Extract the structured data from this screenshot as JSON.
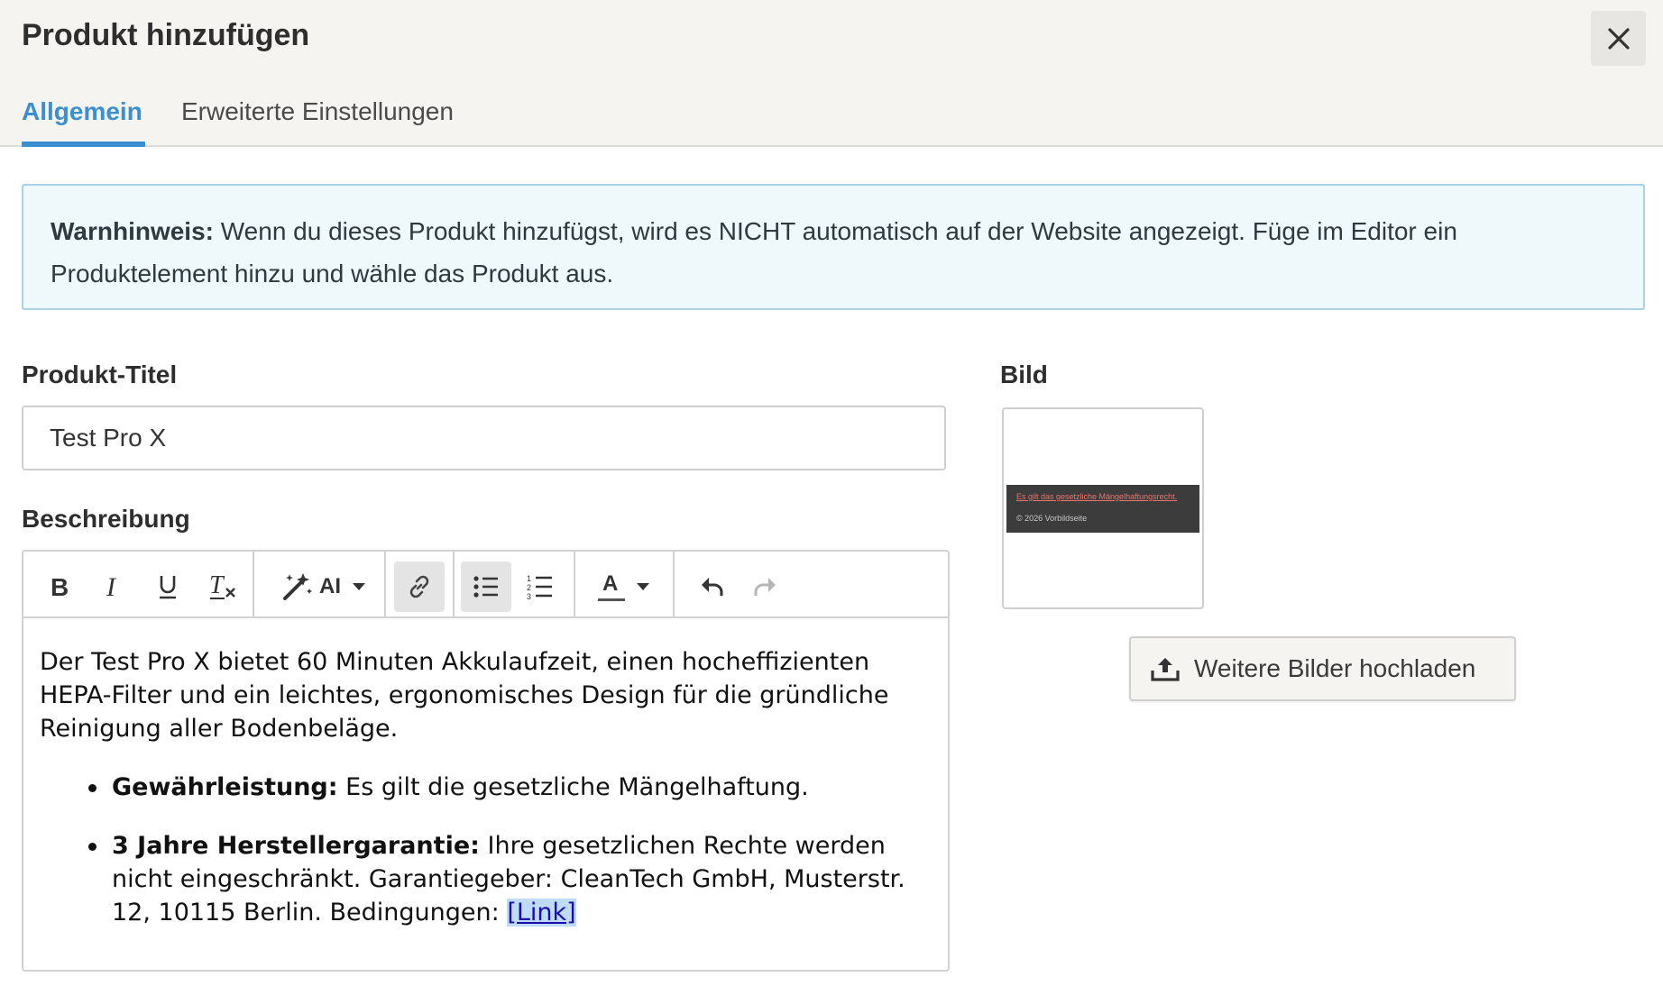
{
  "dialog": {
    "title": "Produkt hinzufügen"
  },
  "tabs": [
    {
      "label": "Allgemein",
      "active": true
    },
    {
      "label": "Erweiterte Einstellungen",
      "active": false
    }
  ],
  "warning": {
    "label": "Warnhinweis:",
    "text": " Wenn du dieses Produkt hinzufügst, wird es NICHT automatisch auf der Website angezeigt. Füge im Editor ein Produktelement hinzu und wähle das Produkt aus."
  },
  "product_title": {
    "label": "Produkt-Titel",
    "value": "Test Pro X"
  },
  "description": {
    "label": "Beschreibung",
    "toolbar": {
      "ai_label": "AI",
      "text_color_label": "A"
    },
    "paragraph": "Der Test Pro X bietet 60 Minuten Akkulaufzeit, einen hocheffizienten HEPA-Filter und ein leichtes, ergonomisches Design für die gründliche Reinigung aller Bodenbeläge.",
    "bullets": [
      {
        "bold": "Gewährleistung:",
        "text": " Es gilt die gesetzliche Mängelhaftung."
      },
      {
        "bold": "3 Jahre Herstellergarantie:",
        "text": " Ihre gesetzlichen Rechte werden nicht eingeschränkt. Garantiegeber: CleanTech GmbH, Musterstr. 12, 10115 Berlin. Bedingungen: ",
        "link": "[Link]"
      }
    ]
  },
  "image": {
    "label": "Bild",
    "thumbnail": {
      "link_text": "Es gilt das gesetzliche Mängelhaftungsrecht.",
      "footer_text": "© 2026 Vorbildseite"
    },
    "upload_button": "Weitere Bilder hochladen"
  },
  "colors": {
    "accent": "#3a8fd0",
    "header_bg": "#f5f4f0",
    "warning_bg": "#eff8fb",
    "warning_border": "#a9d2e4"
  }
}
